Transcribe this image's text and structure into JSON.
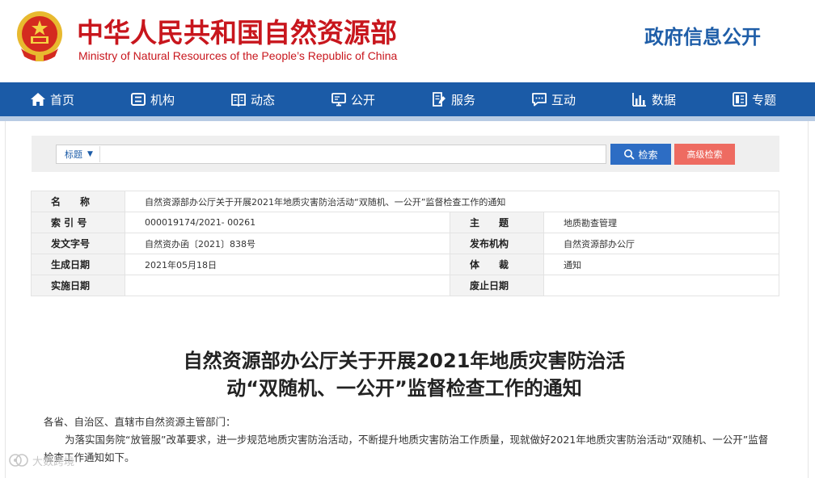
{
  "header": {
    "site_title_cn": "中华人民共和国自然资源部",
    "site_title_en": "Ministry of Natural Resources of the People’s Republic of China",
    "gov_info": "政府信息公开",
    "emblem_icon": "national-emblem-icon",
    "brand_color": "#c8161d",
    "accent_color": "#1b5ba7"
  },
  "nav": {
    "items": [
      {
        "label": "首页",
        "icon": "home-icon"
      },
      {
        "label": "机构",
        "icon": "institution-icon"
      },
      {
        "label": "动态",
        "icon": "news-icon"
      },
      {
        "label": "公开",
        "icon": "disclosure-icon"
      },
      {
        "label": "服务",
        "icon": "service-icon"
      },
      {
        "label": "互动",
        "icon": "interaction-icon"
      },
      {
        "label": "数据",
        "icon": "data-icon"
      },
      {
        "label": "专题",
        "icon": "topic-icon"
      }
    ]
  },
  "search": {
    "select_value": "标题",
    "input_value": "",
    "search_label": "检索",
    "advanced_label": "高级检索"
  },
  "info": {
    "name_label": "名　　称",
    "name_value": "自然资源部办公厅关于开展2021年地质灾害防治活动“双随机、一公开”监督检查工作的通知",
    "index_label": "索 引 号",
    "index_value": "000019174/2021- 00261",
    "subject_label": "主　　题",
    "subject_value": "地质勘查管理",
    "doc_no_label": "发文字号",
    "doc_no_value": "自然资办函〔2021〕838号",
    "publisher_label": "发布机构",
    "publisher_value": "自然资源部办公厅",
    "date_label": "生成日期",
    "date_value": "2021年05月18日",
    "genre_label": "体　　裁",
    "genre_value": "通知",
    "effective_label": "实施日期",
    "effective_value": "",
    "repeal_label": "废止日期",
    "repeal_value": ""
  },
  "article": {
    "title_line1": "自然资源部办公厅关于开展2021年地质灾害防治活",
    "title_line2": "动“双随机、一公开”监督检查工作的通知",
    "salutation": "各省、自治区、直辖市自然资源主管部门：",
    "para1": "为落实国务院“放管服”改革要求，进一步规范地质灾害防治活动，不断提升地质灾害防治工作质量，现就做好2021年地质灾害防治活动“双随机、一公开”监督检查工作通知如下。"
  },
  "watermark": {
    "text": "大数跨境",
    "icon": "watermark-logo-icon"
  }
}
